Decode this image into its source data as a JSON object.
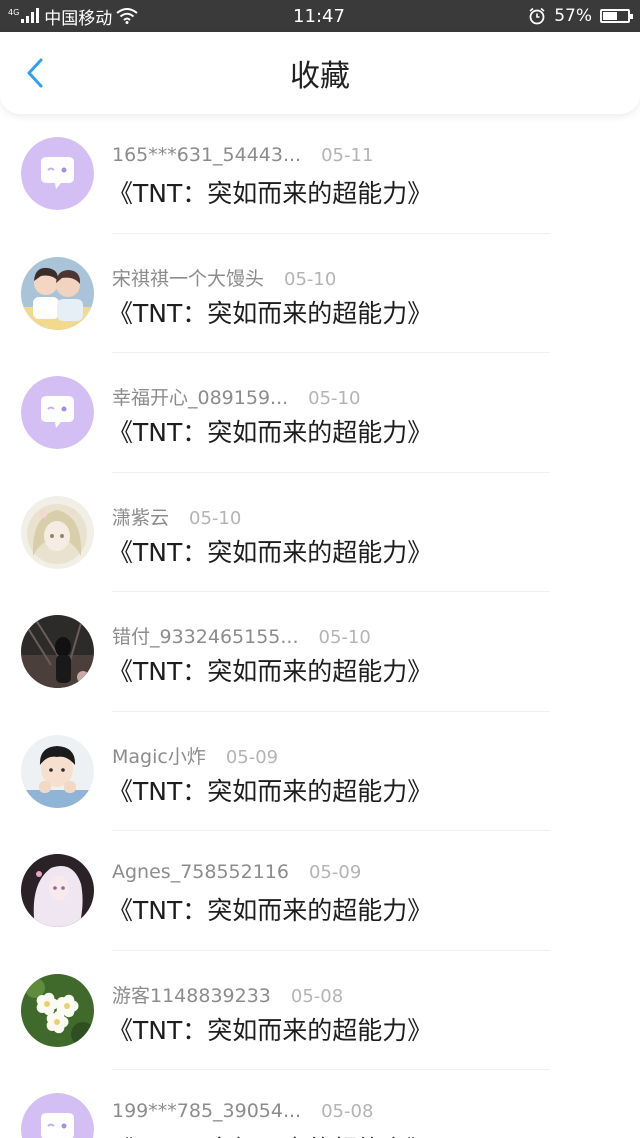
{
  "status_bar": {
    "network_tag": "4G",
    "carrier": "中国移动",
    "time": "11:47",
    "battery_percent_label": "57%",
    "battery_level": 0.57,
    "icons": [
      "signal-icon",
      "wifi-icon",
      "alarm-icon",
      "battery-icon"
    ]
  },
  "header": {
    "title": "收藏",
    "back_icon": "chevron-left-icon",
    "accent_color": "#2ea0f0"
  },
  "items": [
    {
      "user": "165***631_54443...",
      "date": "05-11",
      "title": "《TNT：突如而来的超能力》",
      "avatar": "default-chat"
    },
    {
      "user": "宋祺祺一个大馒头",
      "date": "05-10",
      "title": "《TNT：突如而来的超能力》",
      "avatar": "photo-duo"
    },
    {
      "user": "幸福开心_089159...",
      "date": "05-10",
      "title": "《TNT：突如而来的超能力》",
      "avatar": "default-chat"
    },
    {
      "user": "潇紫云",
      "date": "05-10",
      "title": "《TNT：突如而来的超能力》",
      "avatar": "anime-girl"
    },
    {
      "user": "错付_9332465155...",
      "date": "05-10",
      "title": "《TNT：突如而来的超能力》",
      "avatar": "dark-photo"
    },
    {
      "user": "Magic小炸",
      "date": "05-09",
      "title": "《TNT：突如而来的超能力》",
      "avatar": "boy-photo"
    },
    {
      "user": "Agnes_758552116",
      "date": "05-09",
      "title": "《TNT：突如而来的超能力》",
      "avatar": "anime-white"
    },
    {
      "user": "游客1148839233",
      "date": "05-08",
      "title": "《TNT：突如而来的超能力》",
      "avatar": "flower-photo"
    },
    {
      "user": "199***785_39054...",
      "date": "05-08",
      "title": "《TNT：突如而来的超能力》",
      "avatar": "default-chat"
    }
  ],
  "colors": {
    "default_avatar_bg": "#d3bff3",
    "username": "#8c8c8c",
    "date": "#b4b4b4",
    "title": "#1e1e1e"
  }
}
